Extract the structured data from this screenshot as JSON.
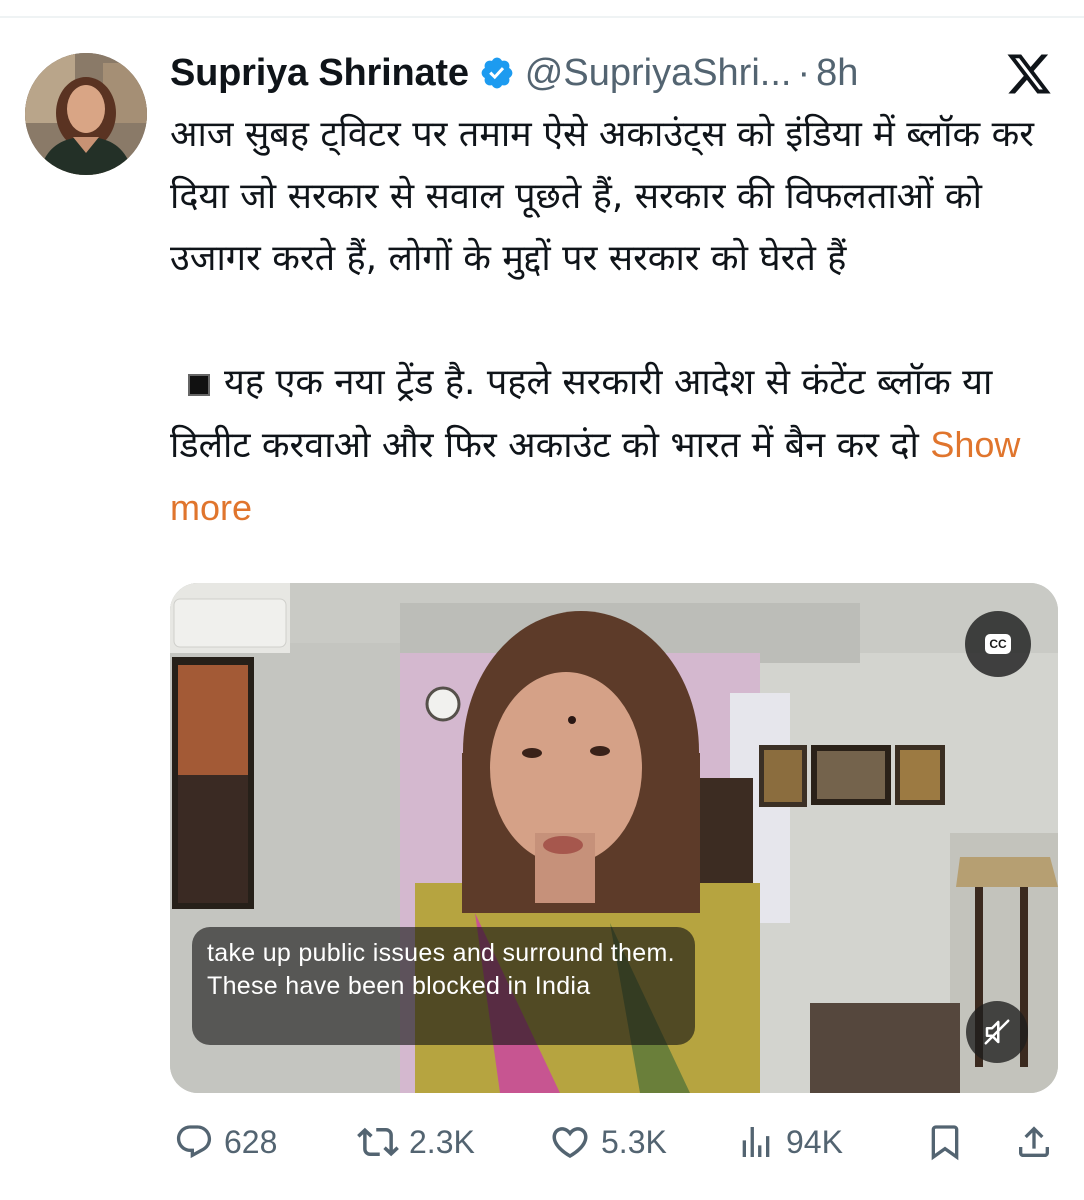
{
  "tweet": {
    "author_name": "Supriya Shrinate",
    "handle": "@SupriyaShri...",
    "separator": "·",
    "time": "8h",
    "text_para1": "आज सुबह ट्विटर पर तमाम ऐसे अकाउंट्स को इंडिया में ब्लॉक कर दिया जो सरकार से सवाल पूछते हैं, सरकार की विफलताओं को उजागर करते हैं, लोगों के मुद्दों पर सरकार को घेरते हैं",
    "text_para2": "यह एक नया ट्रेंड है. पहले सरकारी आदेश से कंटेंट ब्लॉक या डिलीट करवाओ और फिर अकाउंट को भारत में बैन कर दो",
    "show_more": "Show more"
  },
  "video": {
    "cc_label": "CC",
    "caption": "take up public issues and surround them. These have been blocked in India",
    "muted": true
  },
  "actions": {
    "replies": "628",
    "reposts": "2.3K",
    "likes": "5.3K",
    "views": "94K"
  },
  "icons": {
    "verified": "verified-badge-icon",
    "brand": "x-logo-icon",
    "reply": "reply-icon",
    "repost": "repost-icon",
    "like": "heart-icon",
    "views": "views-chart-icon",
    "bookmark": "bookmark-icon",
    "share": "share-icon",
    "mute": "speaker-muted-icon"
  },
  "colors": {
    "verified": "#1d9bf0",
    "secondary_text": "#536471",
    "show_more": "#e0752d",
    "primary_text": "#0f1419"
  }
}
